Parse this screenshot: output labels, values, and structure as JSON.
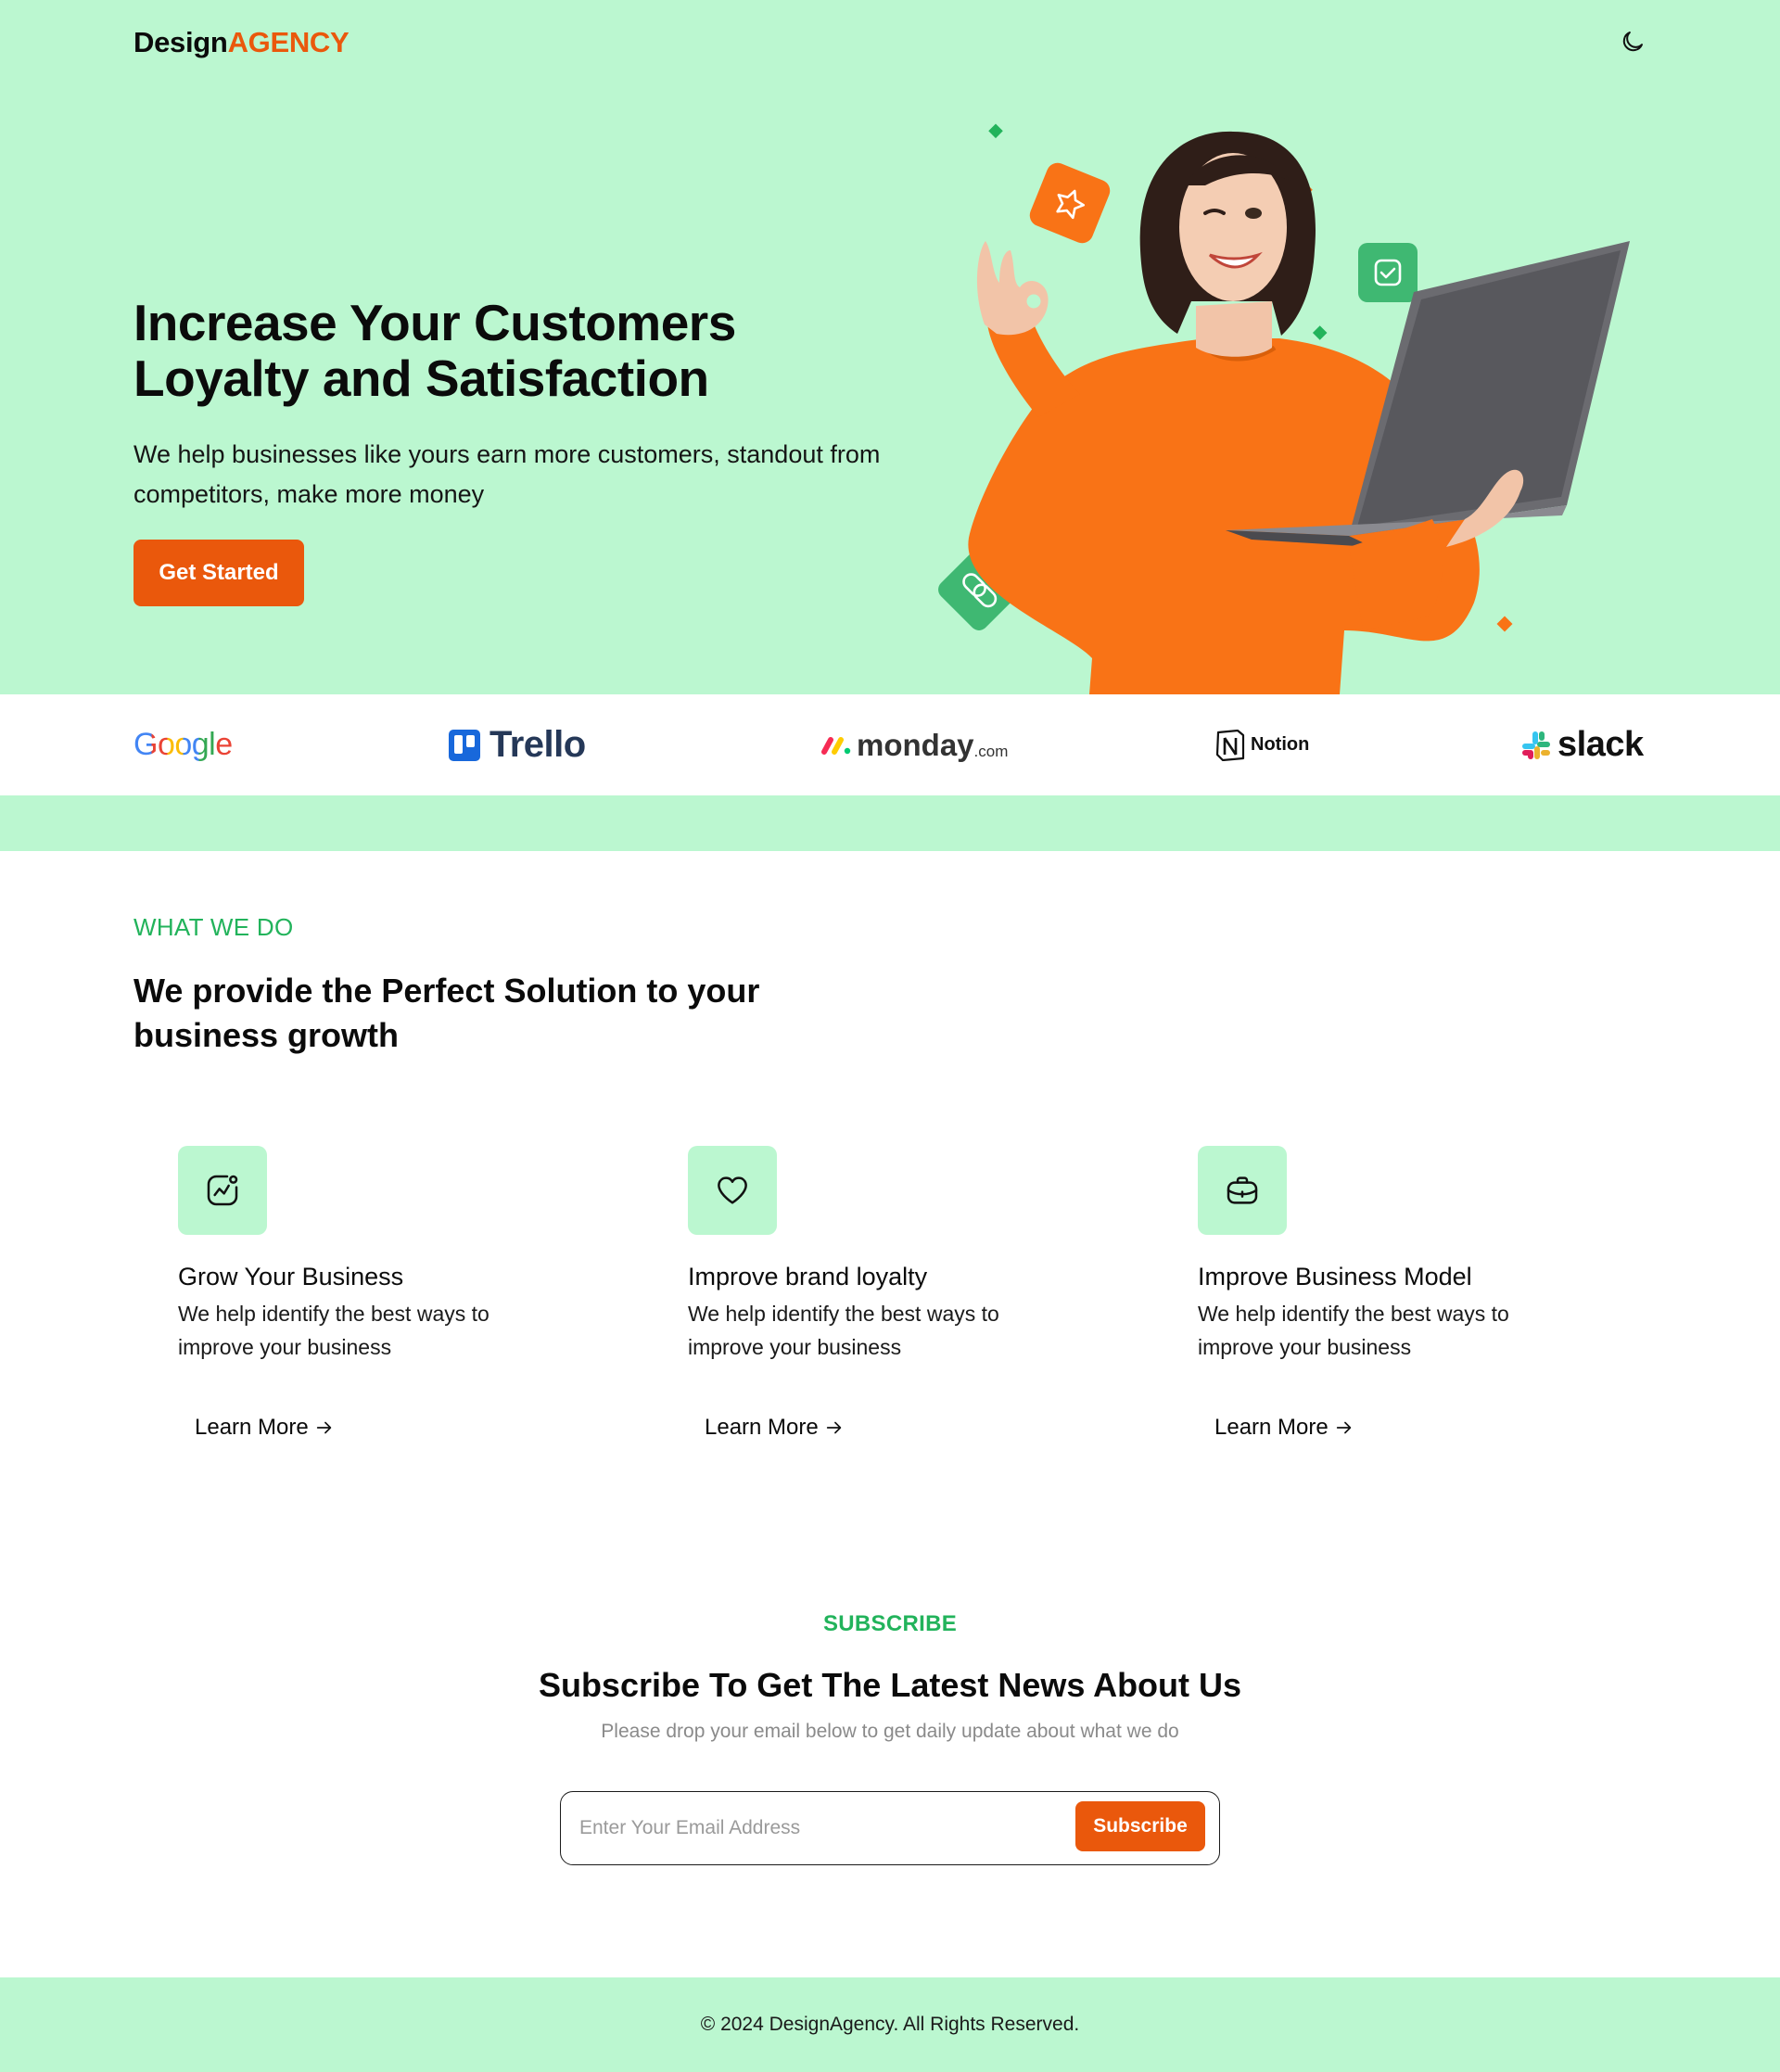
{
  "header": {
    "logo_main": "Design",
    "logo_accent": "AGENCY",
    "theme_toggle_icon": "moon-icon"
  },
  "hero": {
    "title": "Increase Your Customers Loyalty and Satisfaction",
    "subtitle": "We help businesses like yours earn more customers, standout from competitors, make more money",
    "cta_label": "Get Started",
    "image": "woman-with-laptop-illustration"
  },
  "brands": [
    "Google",
    "Trello",
    "monday",
    ".com",
    "Notion",
    "slack"
  ],
  "services": {
    "eyebrow": "WHAT WE DO",
    "title": "We provide the Perfect Solution to your business growth",
    "cards": [
      {
        "icon": "growth-chart-icon",
        "title": "Grow Your Business",
        "text": "We help identify the best ways to improve your business",
        "link": "Learn More"
      },
      {
        "icon": "heart-icon",
        "title": "Improve brand loyalty",
        "text": "We help identify the best ways to improve your business",
        "link": "Learn More"
      },
      {
        "icon": "briefcase-icon",
        "title": "Improve Business Model",
        "text": "We help identify the best ways to improve your business",
        "link": "Learn More"
      }
    ]
  },
  "subscribe": {
    "eyebrow": "SUBSCRIBE",
    "title": "Subscribe To Get The Latest News About Us",
    "text": "Please drop your email below to get daily update about what we do",
    "placeholder": "Enter Your Email Address",
    "button": "Subscribe"
  },
  "footer": {
    "copyright": "© 2024 DesignAgency. All Rights Reserved."
  },
  "colors": {
    "mint": "#bbf7d0",
    "orange": "#ea580c",
    "green": "#22b35b",
    "text": "#0b0b0b"
  }
}
